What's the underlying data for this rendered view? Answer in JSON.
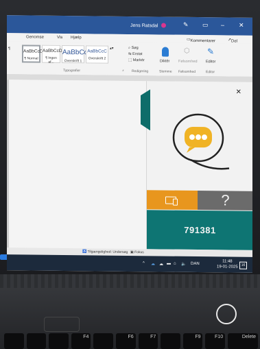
{
  "word": {
    "window_user": "Jens Ratsdal",
    "menu": [
      "Genomse",
      "Vis",
      "Hjælp"
    ],
    "comments_button": "Kommentarer",
    "share_button": "Del",
    "styles": [
      {
        "sample": "AaBbCcDc",
        "name": "¶ Normal"
      },
      {
        "sample": "AaBbCcDc",
        "name": "¶ Ingen af..."
      },
      {
        "sample": "AaBbCc",
        "name": "Overskrift 1"
      },
      {
        "sample": "AaBbCcC",
        "name": "Overskrift 2"
      }
    ],
    "styles_group_label": "Typografier",
    "editing_tools": [
      "Søg",
      "Erstat",
      "Markér"
    ],
    "editing_group_label": "Redigering",
    "dictate_label": "Diktér",
    "sensitivity_label": "Følsomhed",
    "editor_label": "Editor",
    "voice_group_label": "Stemme",
    "sensitivity_group_label": "Følsomhed",
    "editor_group_label": "Editor"
  },
  "panel": {
    "close_symbol": "×",
    "help_symbol": "?",
    "session_code": "791381",
    "colors": {
      "accent_orange": "#e8961e",
      "accent_teal": "#0e7573",
      "help_gray": "#6b6b6b"
    }
  },
  "statusbar": {
    "accessibility": "Tilgængelighed: Undersøg",
    "focus": "Fokus"
  },
  "taskbar": {
    "language": "DAN",
    "time": "11:48",
    "date": "19-01-2025",
    "notification_count": "16"
  },
  "keyboard": {
    "keys": [
      "",
      "",
      "",
      "F4",
      "",
      "F6",
      "F7",
      "",
      "F9",
      "F10",
      "Delete"
    ]
  }
}
